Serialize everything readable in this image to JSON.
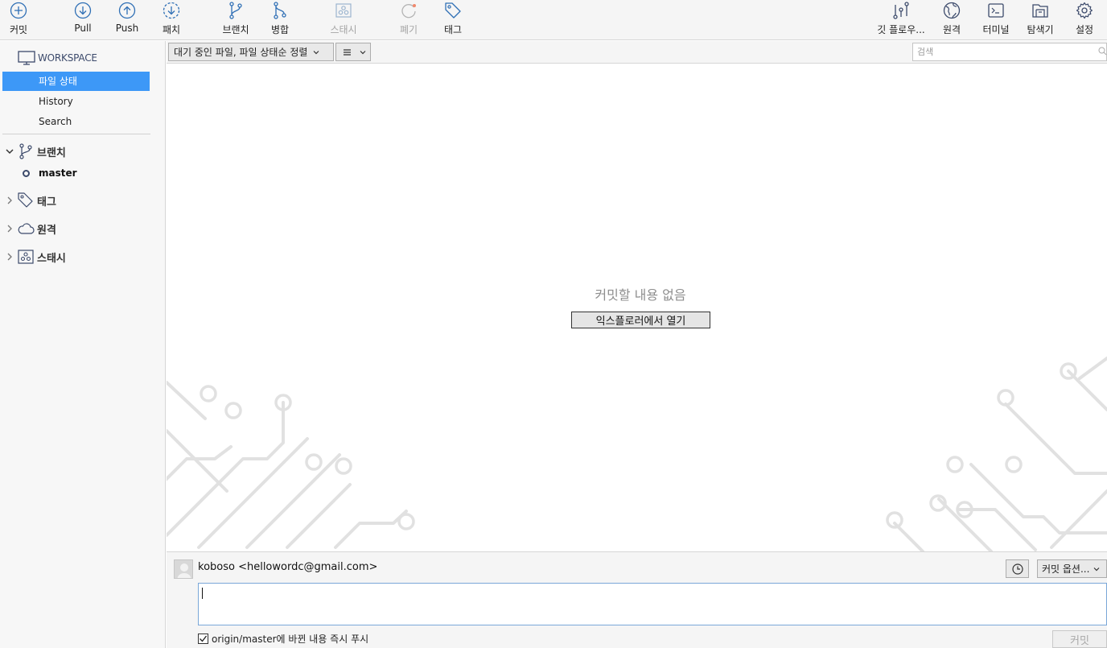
{
  "toolbar": {
    "commit": "커밋",
    "pull": "Pull",
    "push": "Push",
    "fetch": "패치",
    "branch": "브랜치",
    "merge": "병합",
    "stash": "스태시",
    "discard": "폐기",
    "tag": "태그",
    "git_flow": "깃 플로우...",
    "remote": "원격",
    "terminal": "터미널",
    "explorer": "탐색기",
    "settings": "설정"
  },
  "sidebar": {
    "workspace_title": "WORKSPACE",
    "items": [
      {
        "label": "파일 상태",
        "active": true
      },
      {
        "label": "History",
        "active": false
      },
      {
        "label": "Search",
        "active": false
      }
    ],
    "groups": {
      "branches": {
        "label": "브랜치",
        "expanded": true
      },
      "tags": {
        "label": "태그",
        "expanded": false
      },
      "remotes": {
        "label": "원격",
        "expanded": false
      },
      "stashes": {
        "label": "스태시",
        "expanded": false
      }
    },
    "current_branch": "master"
  },
  "filterbar": {
    "sort_selected": "대기 중인 파일, 파일 상태순 정렬",
    "view_icon": "list-icon",
    "search_placeholder": "검색"
  },
  "main": {
    "empty_message": "커밋할 내용 없음",
    "open_in_explorer": "익스플로러에서 열기"
  },
  "commit": {
    "author": "koboso <hellowordc@gmail.com>",
    "options_label": "커밋 옵션...",
    "message_value": "",
    "push_immediately_label": "origin/master에 바뀐 내용 즉시 푸시",
    "push_immediately_checked": true,
    "commit_button": "커밋"
  },
  "colors": {
    "accent": "#3d98f7",
    "icon": "#2f6fb5",
    "disabled": "#a5a5a5"
  }
}
